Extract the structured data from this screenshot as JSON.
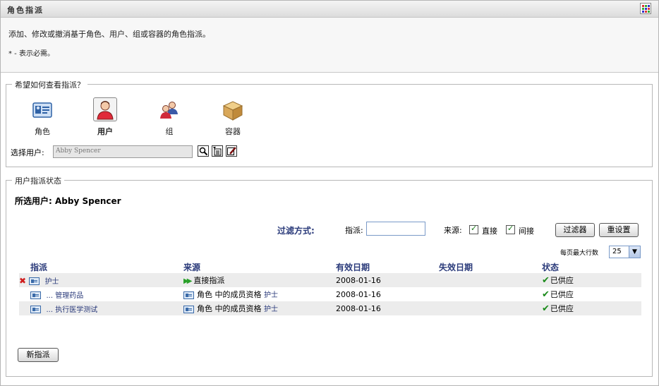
{
  "header": {
    "title": "角色指派"
  },
  "intro": {
    "description": "添加、修改或撤消基于角色、用户、组或容器的角色指派。",
    "required_note": "* - 表示必需。"
  },
  "view_section": {
    "legend": "希望如何查看指派？",
    "options": [
      {
        "label": "角色",
        "icon": "role-card-icon"
      },
      {
        "label": "用户",
        "icon": "user-icon",
        "selected": true
      },
      {
        "label": "组",
        "icon": "group-icon"
      },
      {
        "label": "容器",
        "icon": "container-box-icon"
      }
    ],
    "select_label": "选择用户:",
    "select_value": "Abby Spencer"
  },
  "status_section": {
    "legend": "用户指派状态",
    "selected_user_label": "所选用户:",
    "selected_user": "Abby Spencer",
    "filter": {
      "label": "过滤方式:",
      "assign_label": "指派:",
      "assign_value": "",
      "source_label": "来源:",
      "direct_label": "直接",
      "direct_checked": true,
      "indirect_label": "间接",
      "indirect_checked": true,
      "filter_button": "过滤器",
      "reset_button": "重设置"
    },
    "rows_per_page_label": "每页最大行数",
    "rows_per_page_value": "25",
    "columns": [
      "指派",
      "来源",
      "有效日期",
      "失效日期",
      "状态"
    ],
    "rows": [
      {
        "assignment": "护士",
        "source_text": "直接指派",
        "source_role": "",
        "source_type": "direct",
        "effective": "2008-01-16",
        "expiry": "",
        "status": "已供应",
        "deletable": true
      },
      {
        "assignment": "... 管理药品",
        "source_text": "角色 中的成员资格",
        "source_role": "护士",
        "source_type": "role",
        "effective": "2008-01-16",
        "expiry": "",
        "status": "已供应",
        "deletable": false
      },
      {
        "assignment": "... 执行医学测试",
        "source_text": "角色 中的成员资格",
        "source_role": "护士",
        "source_type": "role",
        "effective": "2008-01-16",
        "expiry": "",
        "status": "已供应",
        "deletable": false
      }
    ],
    "new_button": "新指派"
  },
  "colors": {
    "header_text": "#2a3a7a",
    "status_ok": "#1a8a1a",
    "delete": "#d01c1c"
  }
}
